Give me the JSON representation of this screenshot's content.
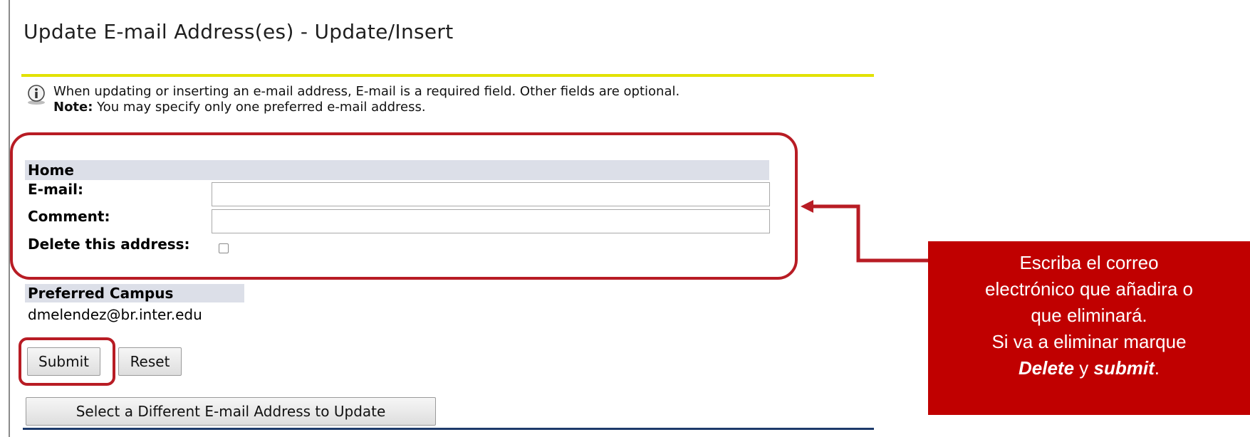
{
  "page": {
    "title": "Update E-mail Address(es) - Update/Insert",
    "info_icon": "info-icon",
    "info_line1": "When updating or inserting an e-mail address, E-mail is a required field. Other fields are optional.",
    "info_note_label": "Note:",
    "info_note_text": " You may specify only one preferred e-mail address."
  },
  "home_section": {
    "header": "Home",
    "email_label": "E-mail:",
    "email_value": "",
    "comment_label": "Comment:",
    "comment_value": "",
    "delete_label": "Delete this address:",
    "delete_checked": false
  },
  "preferred": {
    "header": "Preferred Campus",
    "value": "dmelendez@br.inter.edu"
  },
  "buttons": {
    "submit": "Submit",
    "reset": "Reset",
    "select_different": "Select a Different E-mail Address to Update"
  },
  "callout": {
    "line1": "Escriba el correo",
    "line2": "electrónico que añadira o",
    "line3": "que eliminará.",
    "line4": "Si va a eliminar marque",
    "emph_delete": "Delete",
    "conj": " y ",
    "emph_submit": "submit",
    "period": ".",
    "background_color": "#c00000"
  },
  "colors": {
    "title_underline": "#e2e200",
    "section_header_bg": "#dcdfe8",
    "highlight_border": "#b81c24",
    "bottom_rule": "#1d3a6b"
  }
}
